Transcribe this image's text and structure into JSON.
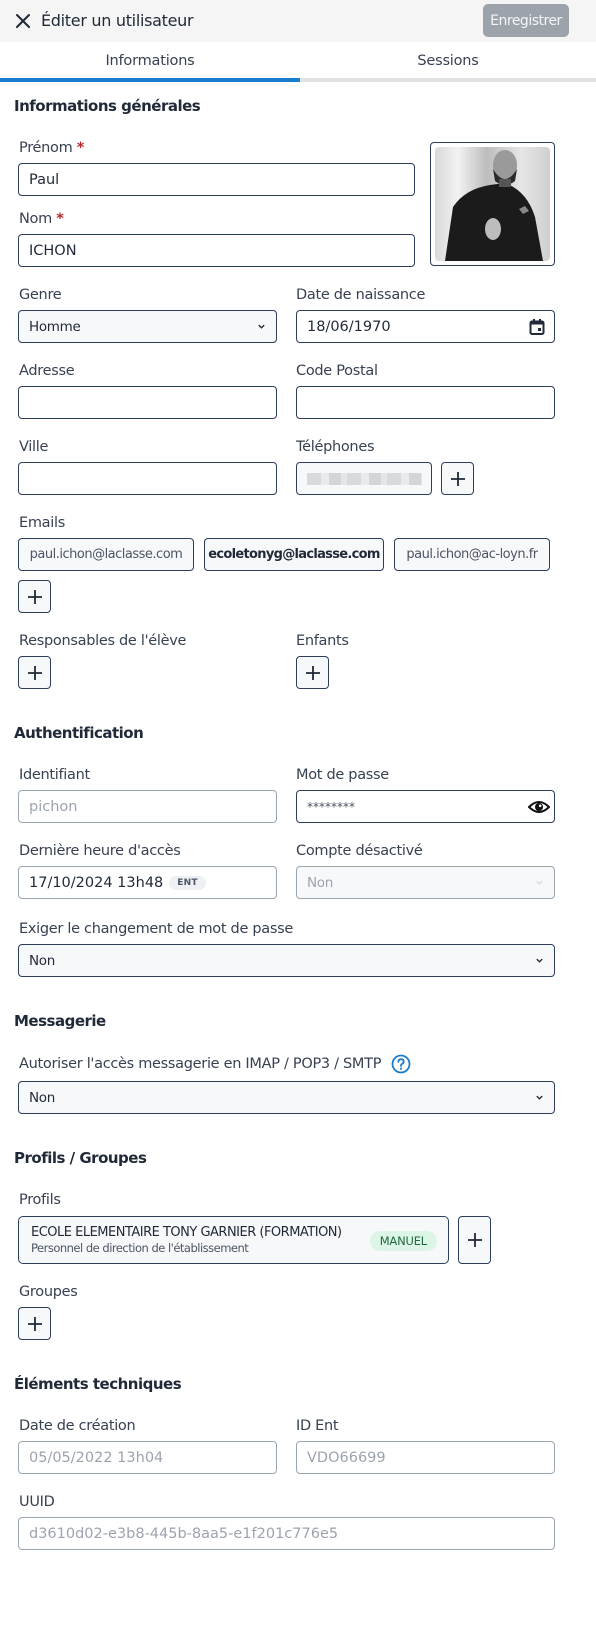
{
  "header": {
    "title": "Éditer un utilisateur",
    "save_label": "Enregistrer"
  },
  "tabs": [
    {
      "label": "Informations",
      "active": true
    },
    {
      "label": "Sessions",
      "active": false
    }
  ],
  "colors": {
    "accent": "#1a7ccf",
    "required": "#c0232a",
    "badge_manuel_bg": "#dcf5e6",
    "badge_manuel_text": "#1f6b3f"
  },
  "general": {
    "title": "Informations générales",
    "prenom": {
      "label": "Prénom",
      "required_mark": "*",
      "value": "Paul"
    },
    "nom": {
      "label": "Nom",
      "required_mark": "*",
      "value": "ICHON"
    },
    "genre": {
      "label": "Genre",
      "value": "Homme"
    },
    "date_naissance": {
      "label": "Date de naissance",
      "value": "18/06/1970"
    },
    "adresse": {
      "label": "Adresse",
      "value": ""
    },
    "code_postal": {
      "label": "Code Postal",
      "value": ""
    },
    "ville": {
      "label": "Ville",
      "value": ""
    },
    "telephones": {
      "label": "Téléphones"
    },
    "emails": {
      "label": "Emails",
      "items": [
        {
          "value": "paul.ichon@laclasse.com",
          "primary": false
        },
        {
          "value": "ecoletonyg@laclasse.com",
          "primary": true
        },
        {
          "value": "paul.ichon@ac-loyn.fr",
          "primary": false
        }
      ]
    },
    "responsables": {
      "label": "Responsables de l'élève"
    },
    "enfants": {
      "label": "Enfants"
    }
  },
  "auth": {
    "title": "Authentification",
    "identifiant": {
      "label": "Identifiant",
      "value": "pichon"
    },
    "mot_de_passe": {
      "label": "Mot de passe",
      "value": "********"
    },
    "derniere_acces": {
      "label": "Dernière heure d'accès",
      "value": "17/10/2024 13h48",
      "badge": "ENT"
    },
    "compte_desactive": {
      "label": "Compte désactivé",
      "value": "Non"
    },
    "exiger_changement": {
      "label": "Exiger le changement de mot de passe",
      "value": "Non"
    }
  },
  "messagerie": {
    "title": "Messagerie",
    "imap": {
      "label": "Autoriser l'accès messagerie en IMAP / POP3 / SMTP",
      "value": "Non"
    }
  },
  "profils_groupes": {
    "title": "Profils / Groupes",
    "profils_label": "Profils",
    "profils": [
      {
        "etablissement": "ECOLE ELEMENTAIRE TONY GARNIER (FORMATION)",
        "role": "Personnel de direction de l'établissement",
        "badge": "MANUEL"
      }
    ],
    "groupes_label": "Groupes"
  },
  "technique": {
    "title": "Éléments techniques",
    "date_creation": {
      "label": "Date de création",
      "value": "05/05/2022 13h04"
    },
    "id_ent": {
      "label": "ID Ent",
      "value": "VDO66699"
    },
    "uuid": {
      "label": "UUID",
      "value": "d3610d02-e3b8-445b-8aa5-e1f201c776e5"
    }
  }
}
